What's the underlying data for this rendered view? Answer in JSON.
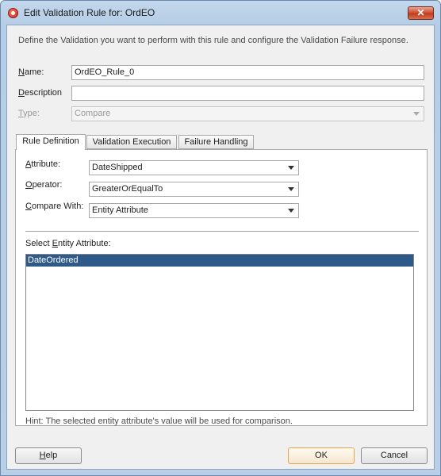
{
  "window": {
    "title": "Edit Validation Rule for: OrdEO",
    "close_glyph": "✕"
  },
  "intro_text": "Define the Validation you want to perform with this rule and configure the Validation Failure response.",
  "form": {
    "name_label": "Name:",
    "name_value": "OrdEO_Rule_0",
    "description_label": "Description",
    "description_value": "",
    "type_label": "Type:",
    "type_value": "Compare"
  },
  "tabs": [
    {
      "label": "Rule Definition",
      "active": true
    },
    {
      "label": "Validation Execution",
      "active": false
    },
    {
      "label": "Failure Handling",
      "active": false
    }
  ],
  "rule_definition": {
    "attribute_label": "Attribute:",
    "attribute_value": "DateShipped",
    "operator_label": "Operator:",
    "operator_value": "GreaterOrEqualTo",
    "compare_with_label": "Compare With:",
    "compare_with_value": "Entity Attribute",
    "select_entity_label": "Select Entity Attribute:",
    "entity_attributes": [
      "DateOrdered"
    ],
    "selected_index": 0,
    "hint": "Hint: The selected entity attribute's value will be used for comparison."
  },
  "buttons": {
    "help": "Help",
    "ok": "OK",
    "cancel": "Cancel"
  },
  "colors": {
    "selection": "#2e5a8a",
    "window_frame": "#b9cfe7",
    "default_button_border": "#e6a44d"
  }
}
